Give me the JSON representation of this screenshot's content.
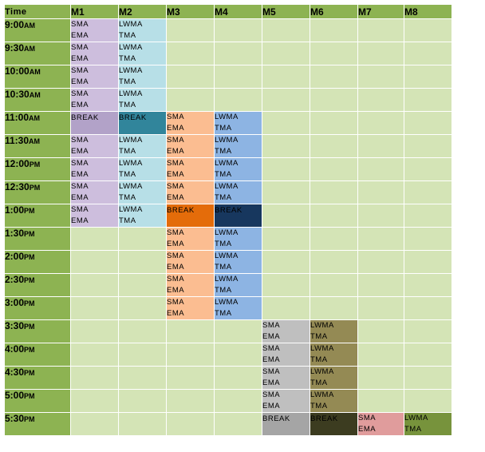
{
  "header": {
    "time": "Time",
    "machines": [
      "M1",
      "M2",
      "M3",
      "M4",
      "M5",
      "M6",
      "M7",
      "M8"
    ]
  },
  "colors": {
    "header_green": "#8db352",
    "empty_cell": "#d4e4b6",
    "m1_sma_ema": "#cdbedd",
    "m2_lwma_tma": "#b7dfe7",
    "m3_sma_ema": "#fbbd91",
    "m4_lwma_tma": "#8db4e3",
    "m5_sma_ema": "#bfbfbf",
    "m6_lwma_tma": "#948a54",
    "m7_sma_ema": "#e09c9c",
    "m8_lwma_tma": "#77933c"
  },
  "rows": [
    {
      "time": "9:00",
      "ampm": "AM",
      "cells": [
        [
          "SMA",
          "EMA"
        ],
        [
          "LWMA",
          "TMA"
        ],
        null,
        null,
        null,
        null,
        null,
        null
      ]
    },
    {
      "time": "9:30",
      "ampm": "AM",
      "cells": [
        [
          "SMA",
          "EMA"
        ],
        [
          "LWMA",
          "TMA"
        ],
        null,
        null,
        null,
        null,
        null,
        null
      ]
    },
    {
      "time": "10:00",
      "ampm": "AM",
      "cells": [
        [
          "SMA",
          "EMA"
        ],
        [
          "LWMA",
          "TMA"
        ],
        null,
        null,
        null,
        null,
        null,
        null
      ]
    },
    {
      "time": "10:30",
      "ampm": "AM",
      "cells": [
        [
          "SMA",
          "EMA"
        ],
        [
          "LWMA",
          "TMA"
        ],
        null,
        null,
        null,
        null,
        null,
        null
      ]
    },
    {
      "time": "11:00",
      "ampm": "AM",
      "cells": [
        [
          "BREAK"
        ],
        [
          "BREAK"
        ],
        [
          "SMA",
          "EMA"
        ],
        [
          "LWMA",
          "TMA"
        ],
        null,
        null,
        null,
        null
      ]
    },
    {
      "time": "11:30",
      "ampm": "AM",
      "cells": [
        [
          "SMA",
          "EMA"
        ],
        [
          "LWMA",
          "TMA"
        ],
        [
          "SMA",
          "EMA"
        ],
        [
          "LWMA",
          "TMA"
        ],
        null,
        null,
        null,
        null
      ]
    },
    {
      "time": "12:00",
      "ampm": "PM",
      "cells": [
        [
          "SMA",
          "EMA"
        ],
        [
          "LWMA",
          "TMA"
        ],
        [
          "SMA",
          "EMA"
        ],
        [
          "LWMA",
          "TMA"
        ],
        null,
        null,
        null,
        null
      ]
    },
    {
      "time": "12:30",
      "ampm": "PM",
      "cells": [
        [
          "SMA",
          "EMA"
        ],
        [
          "LWMA",
          "TMA"
        ],
        [
          "SMA",
          "EMA"
        ],
        [
          "LWMA",
          "TMA"
        ],
        null,
        null,
        null,
        null
      ]
    },
    {
      "time": "1:00",
      "ampm": "PM",
      "cells": [
        [
          "SMA",
          "EMA"
        ],
        [
          "LWMA",
          "TMA"
        ],
        [
          "BREAK"
        ],
        [
          "BREAK"
        ],
        null,
        null,
        null,
        null
      ]
    },
    {
      "time": "1:30",
      "ampm": "PM",
      "cells": [
        null,
        null,
        [
          "SMA",
          "EMA"
        ],
        [
          "LWMA",
          "TMA"
        ],
        null,
        null,
        null,
        null
      ]
    },
    {
      "time": "2:00",
      "ampm": "PM",
      "cells": [
        null,
        null,
        [
          "SMA",
          "EMA"
        ],
        [
          "LWMA",
          "TMA"
        ],
        null,
        null,
        null,
        null
      ]
    },
    {
      "time": "2:30",
      "ampm": "PM",
      "cells": [
        null,
        null,
        [
          "SMA",
          "EMA"
        ],
        [
          "LWMA",
          "TMA"
        ],
        null,
        null,
        null,
        null
      ]
    },
    {
      "time": "3:00",
      "ampm": "PM",
      "cells": [
        null,
        null,
        [
          "SMA",
          "EMA"
        ],
        [
          "LWMA",
          "TMA"
        ],
        null,
        null,
        null,
        null
      ]
    },
    {
      "time": "3:30",
      "ampm": "PM",
      "cells": [
        null,
        null,
        null,
        null,
        [
          "SMA",
          "EMA"
        ],
        [
          "LWMA",
          "TMA"
        ],
        null,
        null
      ]
    },
    {
      "time": "4:00",
      "ampm": "PM",
      "cells": [
        null,
        null,
        null,
        null,
        [
          "SMA",
          "EMA"
        ],
        [
          "LWMA",
          "TMA"
        ],
        null,
        null
      ]
    },
    {
      "time": "4:30",
      "ampm": "PM",
      "cells": [
        null,
        null,
        null,
        null,
        [
          "SMA",
          "EMA"
        ],
        [
          "LWMA",
          "TMA"
        ],
        null,
        null
      ]
    },
    {
      "time": "5:00",
      "ampm": "PM",
      "cells": [
        null,
        null,
        null,
        null,
        [
          "SMA",
          "EMA"
        ],
        [
          "LWMA",
          "TMA"
        ],
        null,
        null
      ]
    },
    {
      "time": "5:30",
      "ampm": "PM",
      "cells": [
        null,
        null,
        null,
        null,
        [
          "BREAK"
        ],
        [
          "BREAK"
        ],
        [
          "SMA",
          "EMA"
        ],
        [
          "LWMA",
          "TMA"
        ]
      ]
    }
  ]
}
